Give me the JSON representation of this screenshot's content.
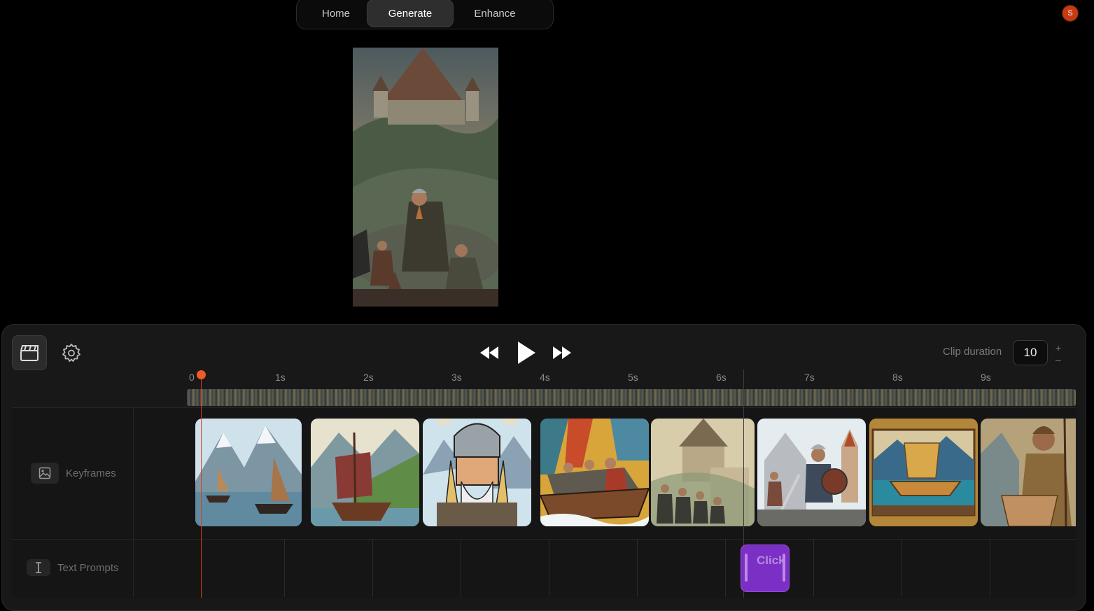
{
  "nav": {
    "tabs": [
      {
        "label": "Home"
      },
      {
        "label": "Generate",
        "active": true
      },
      {
        "label": "Enhance"
      }
    ]
  },
  "user": {
    "avatar_initial": "S",
    "avatar_color": "#c83a12"
  },
  "toolbar": {
    "clip_duration_label": "Clip duration",
    "clip_duration_value": "10",
    "increment": "+",
    "decrement": "–"
  },
  "ruler": {
    "ticks": [
      "0",
      "1s",
      "2s",
      "3s",
      "4s",
      "5s",
      "6s",
      "7s",
      "8s",
      "9s"
    ]
  },
  "tracks": {
    "keyframes_label": "Keyframes",
    "text_prompts_label": "Text Prompts",
    "keyframe_count": 8,
    "prompt_block_text": "Click"
  },
  "colors": {
    "playhead": "#f05a24",
    "prompt_block": "#7b2fc4",
    "panel_bg": "#181818"
  }
}
